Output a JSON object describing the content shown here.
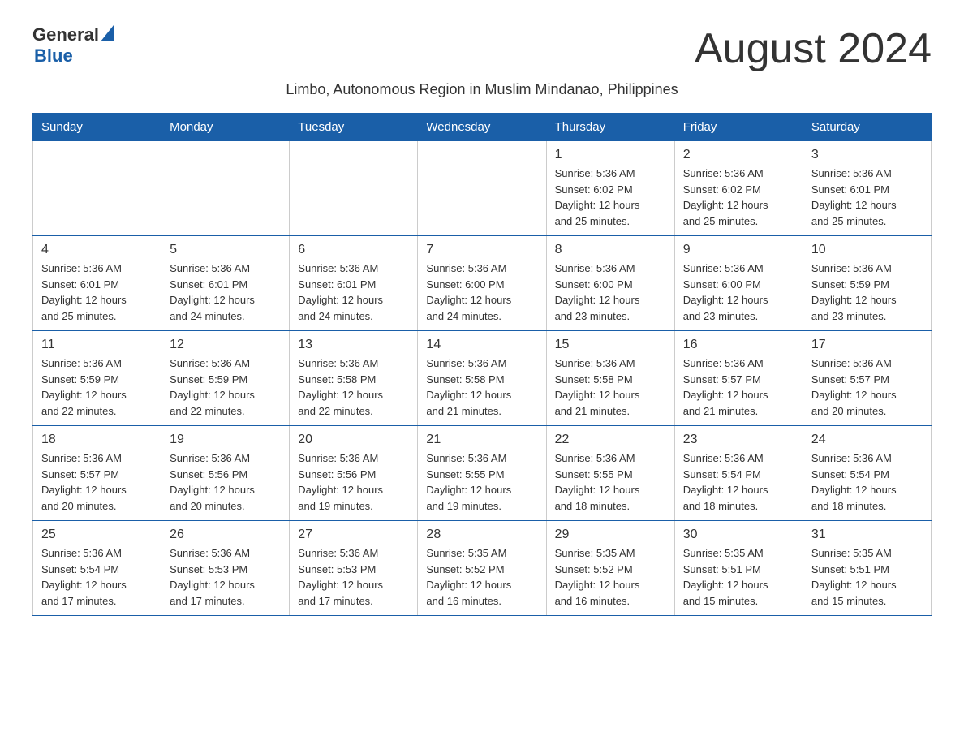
{
  "header": {
    "logo_general": "General",
    "logo_blue": "Blue",
    "month_title": "August 2024",
    "subtitle": "Limbo, Autonomous Region in Muslim Mindanao, Philippines"
  },
  "days_of_week": [
    "Sunday",
    "Monday",
    "Tuesday",
    "Wednesday",
    "Thursday",
    "Friday",
    "Saturday"
  ],
  "weeks": [
    {
      "days": [
        {
          "number": "",
          "info": ""
        },
        {
          "number": "",
          "info": ""
        },
        {
          "number": "",
          "info": ""
        },
        {
          "number": "",
          "info": ""
        },
        {
          "number": "1",
          "info": "Sunrise: 5:36 AM\nSunset: 6:02 PM\nDaylight: 12 hours\nand 25 minutes."
        },
        {
          "number": "2",
          "info": "Sunrise: 5:36 AM\nSunset: 6:02 PM\nDaylight: 12 hours\nand 25 minutes."
        },
        {
          "number": "3",
          "info": "Sunrise: 5:36 AM\nSunset: 6:01 PM\nDaylight: 12 hours\nand 25 minutes."
        }
      ]
    },
    {
      "days": [
        {
          "number": "4",
          "info": "Sunrise: 5:36 AM\nSunset: 6:01 PM\nDaylight: 12 hours\nand 25 minutes."
        },
        {
          "number": "5",
          "info": "Sunrise: 5:36 AM\nSunset: 6:01 PM\nDaylight: 12 hours\nand 24 minutes."
        },
        {
          "number": "6",
          "info": "Sunrise: 5:36 AM\nSunset: 6:01 PM\nDaylight: 12 hours\nand 24 minutes."
        },
        {
          "number": "7",
          "info": "Sunrise: 5:36 AM\nSunset: 6:00 PM\nDaylight: 12 hours\nand 24 minutes."
        },
        {
          "number": "8",
          "info": "Sunrise: 5:36 AM\nSunset: 6:00 PM\nDaylight: 12 hours\nand 23 minutes."
        },
        {
          "number": "9",
          "info": "Sunrise: 5:36 AM\nSunset: 6:00 PM\nDaylight: 12 hours\nand 23 minutes."
        },
        {
          "number": "10",
          "info": "Sunrise: 5:36 AM\nSunset: 5:59 PM\nDaylight: 12 hours\nand 23 minutes."
        }
      ]
    },
    {
      "days": [
        {
          "number": "11",
          "info": "Sunrise: 5:36 AM\nSunset: 5:59 PM\nDaylight: 12 hours\nand 22 minutes."
        },
        {
          "number": "12",
          "info": "Sunrise: 5:36 AM\nSunset: 5:59 PM\nDaylight: 12 hours\nand 22 minutes."
        },
        {
          "number": "13",
          "info": "Sunrise: 5:36 AM\nSunset: 5:58 PM\nDaylight: 12 hours\nand 22 minutes."
        },
        {
          "number": "14",
          "info": "Sunrise: 5:36 AM\nSunset: 5:58 PM\nDaylight: 12 hours\nand 21 minutes."
        },
        {
          "number": "15",
          "info": "Sunrise: 5:36 AM\nSunset: 5:58 PM\nDaylight: 12 hours\nand 21 minutes."
        },
        {
          "number": "16",
          "info": "Sunrise: 5:36 AM\nSunset: 5:57 PM\nDaylight: 12 hours\nand 21 minutes."
        },
        {
          "number": "17",
          "info": "Sunrise: 5:36 AM\nSunset: 5:57 PM\nDaylight: 12 hours\nand 20 minutes."
        }
      ]
    },
    {
      "days": [
        {
          "number": "18",
          "info": "Sunrise: 5:36 AM\nSunset: 5:57 PM\nDaylight: 12 hours\nand 20 minutes."
        },
        {
          "number": "19",
          "info": "Sunrise: 5:36 AM\nSunset: 5:56 PM\nDaylight: 12 hours\nand 20 minutes."
        },
        {
          "number": "20",
          "info": "Sunrise: 5:36 AM\nSunset: 5:56 PM\nDaylight: 12 hours\nand 19 minutes."
        },
        {
          "number": "21",
          "info": "Sunrise: 5:36 AM\nSunset: 5:55 PM\nDaylight: 12 hours\nand 19 minutes."
        },
        {
          "number": "22",
          "info": "Sunrise: 5:36 AM\nSunset: 5:55 PM\nDaylight: 12 hours\nand 18 minutes."
        },
        {
          "number": "23",
          "info": "Sunrise: 5:36 AM\nSunset: 5:54 PM\nDaylight: 12 hours\nand 18 minutes."
        },
        {
          "number": "24",
          "info": "Sunrise: 5:36 AM\nSunset: 5:54 PM\nDaylight: 12 hours\nand 18 minutes."
        }
      ]
    },
    {
      "days": [
        {
          "number": "25",
          "info": "Sunrise: 5:36 AM\nSunset: 5:54 PM\nDaylight: 12 hours\nand 17 minutes."
        },
        {
          "number": "26",
          "info": "Sunrise: 5:36 AM\nSunset: 5:53 PM\nDaylight: 12 hours\nand 17 minutes."
        },
        {
          "number": "27",
          "info": "Sunrise: 5:36 AM\nSunset: 5:53 PM\nDaylight: 12 hours\nand 17 minutes."
        },
        {
          "number": "28",
          "info": "Sunrise: 5:35 AM\nSunset: 5:52 PM\nDaylight: 12 hours\nand 16 minutes."
        },
        {
          "number": "29",
          "info": "Sunrise: 5:35 AM\nSunset: 5:52 PM\nDaylight: 12 hours\nand 16 minutes."
        },
        {
          "number": "30",
          "info": "Sunrise: 5:35 AM\nSunset: 5:51 PM\nDaylight: 12 hours\nand 15 minutes."
        },
        {
          "number": "31",
          "info": "Sunrise: 5:35 AM\nSunset: 5:51 PM\nDaylight: 12 hours\nand 15 minutes."
        }
      ]
    }
  ]
}
